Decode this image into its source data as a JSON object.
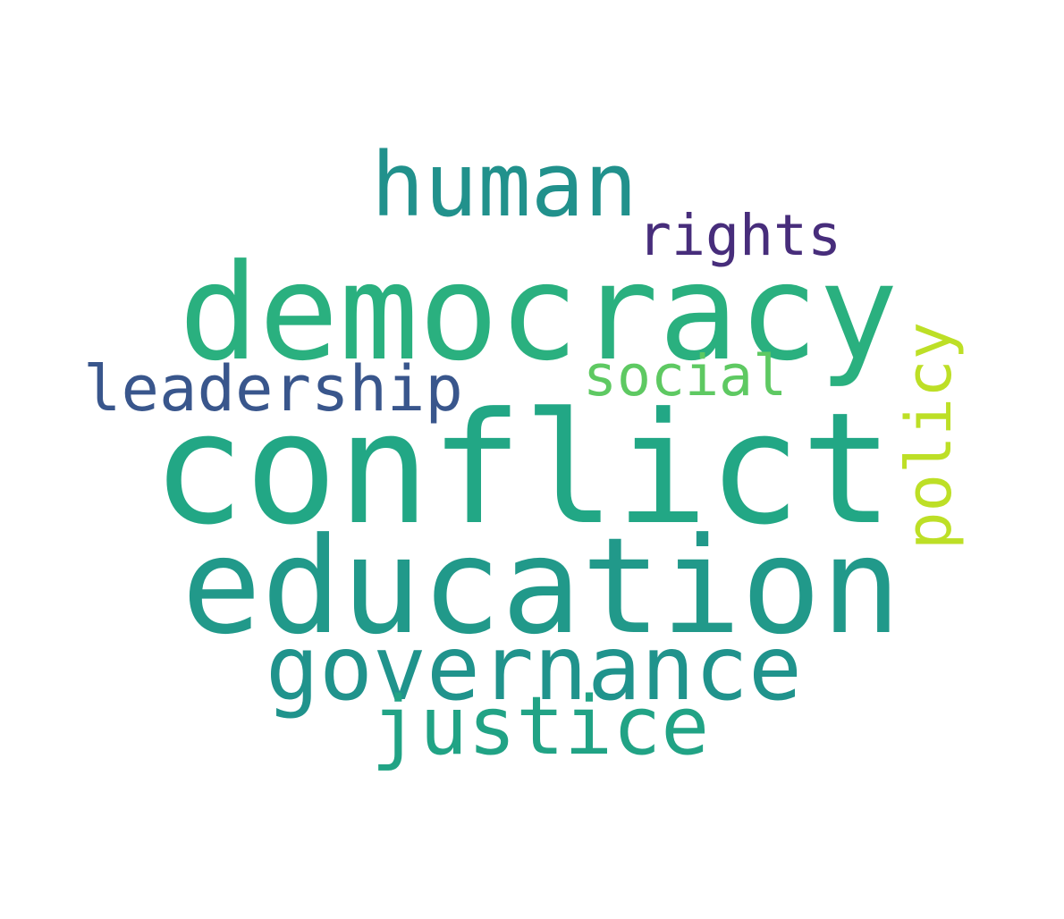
{
  "words": [
    {
      "text": "conflict",
      "color": "#22a785"
    },
    {
      "text": "education",
      "color": "#21998a"
    },
    {
      "text": "democracy",
      "color": "#2ab07f"
    },
    {
      "text": "governance",
      "color": "#20938c"
    },
    {
      "text": "human",
      "color": "#21918c"
    },
    {
      "text": "justice",
      "color": "#21a385"
    },
    {
      "text": "leadership",
      "color": "#39568c"
    },
    {
      "text": "policy",
      "color": "#bddf26"
    },
    {
      "text": "rights",
      "color": "#472d7b"
    },
    {
      "text": "social",
      "color": "#5ec962"
    }
  ]
}
